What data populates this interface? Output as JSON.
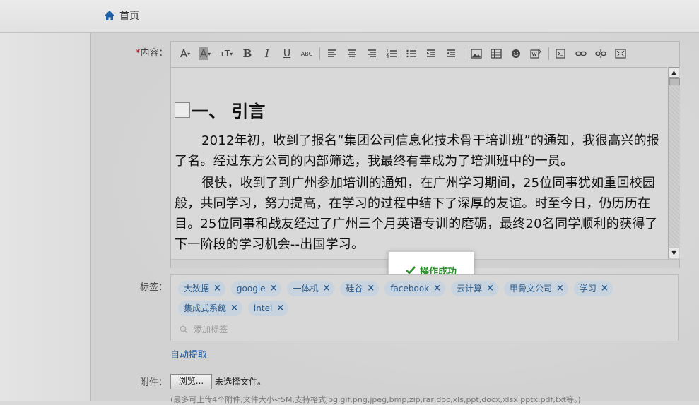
{
  "topbar": {
    "home_label": "首页",
    "home_icon": "home-icon"
  },
  "form": {
    "content_label": "内容：",
    "required_mark": "*",
    "tags_label": "标签：",
    "attach_label": "附件："
  },
  "toolbar": {
    "buttons": [
      {
        "name": "font-family-button",
        "glyph": "A·"
      },
      {
        "name": "font-color-button",
        "glyph": "A·"
      },
      {
        "name": "font-size-button",
        "glyph": "тT·"
      },
      {
        "name": "bold-button",
        "glyph": "B"
      },
      {
        "name": "italic-button",
        "glyph": "I"
      },
      {
        "name": "underline-button",
        "glyph": "U"
      },
      {
        "name": "strikethrough-button",
        "glyph": "ABC"
      }
    ]
  },
  "document": {
    "heading": "一、 引言",
    "paragraphs": [
      "2012年初，收到了报名“集团公司信息化技术骨干培训班”的通知，我很高兴的报了名。经过东方公司的内部筛选，我最终有幸成为了培训班中的一员。",
      "很快，收到了到广州参加培训的通知，在广州学习期间，25位同事犹如重回校园般，共同学习，努力提高，在学习的过程中结下了深厚的友谊。时至今日，仍历历在目。25位同事和战友经过了广州三个月英语专训的磨砺，最终20名同学顺利的获得了下一阶段的学习机会--出国学习。"
    ]
  },
  "toast": {
    "message": "操作成功",
    "icon": "check-icon",
    "color": "#2f8f2f"
  },
  "tags": {
    "items": [
      "大数据",
      "google",
      "一体机",
      "硅谷",
      "facebook",
      "云计算",
      "甲骨文公司",
      "学习",
      "集成式系统",
      "intel"
    ],
    "remove_glyph": "×",
    "add_placeholder": "添加标签"
  },
  "auto_extract": "自动提取",
  "attachment": {
    "browse_label": "浏览...",
    "no_file": "未选择文件。",
    "hint": "(最多可上传4个附件,文件大小<5M,支持格式jpg,gif,png,jpeg,bmp,zip,rar,doc,xls,ppt,docx,xlsx,pptx,pdf,txt等。)"
  }
}
